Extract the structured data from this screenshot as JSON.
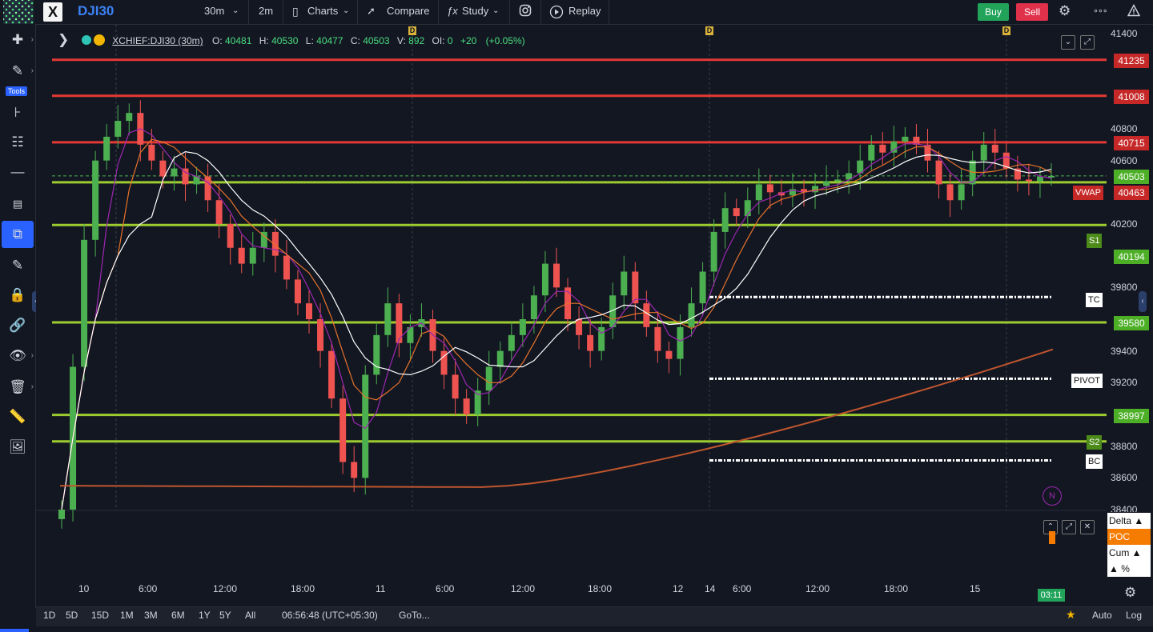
{
  "topbar": {
    "symbol": "DJI30",
    "interval": "30m",
    "interval2": "2m",
    "charts_label": "Charts",
    "compare_label": "Compare",
    "study_label": "Study",
    "replay_label": "Replay",
    "buy_label": "Buy",
    "sell_label": "Sell",
    "more_label": "∘∘∘"
  },
  "tools": {
    "tools_label": "Tools"
  },
  "legend": {
    "title": "XCHIEF:DJI30 (30m)",
    "o_label": "O:",
    "o": "40481",
    "h_label": "H:",
    "h": "40530",
    "l_label": "L:",
    "l": "40477",
    "c_label": "C:",
    "c": "40503",
    "v_label": "V:",
    "v": "892",
    "oi_label": "OI:",
    "oi": "0",
    "change": "+20",
    "change_pct": "(+0.05%)"
  },
  "price_axis": {
    "ticks": [
      "41400",
      "40800",
      "40600",
      "40200",
      "39800",
      "39400",
      "39200",
      "38800",
      "38600",
      "38400"
    ],
    "tag_41235": "41235",
    "tag_41008": "41008",
    "tag_40715": "40715",
    "tag_40503": "40503",
    "tag_40463": "40463",
    "tag_40194": "40194",
    "tag_39580": "39580",
    "tag_38997": "38997"
  },
  "chart_tags": {
    "vwap": "VWAP",
    "s1": "S1",
    "s2": "S2",
    "tc": "TC",
    "pivot": "PIVOT",
    "bc": "BC",
    "n": "N",
    "d": "D"
  },
  "time_axis": {
    "labels": [
      "10",
      "6:00",
      "12:00",
      "18:00",
      "11",
      "6:00",
      "12:00",
      "18:00",
      "12",
      "14",
      "6:00",
      "12:00",
      "18:00",
      "15"
    ],
    "countdown": "03:11"
  },
  "volume_panel": {
    "delta": "Delta ▲",
    "poc": "POC",
    "cum": "Cum ▲",
    "pct": "▲ %"
  },
  "bottombar": {
    "ranges": [
      "1D",
      "5D",
      "15D",
      "1M",
      "3M",
      "6M",
      "1Y",
      "5Y",
      "All"
    ],
    "clock": "06:56:48 (UTC+05:30)",
    "goto": "GoTo...",
    "auto": "Auto",
    "log": "Log"
  },
  "colors": {
    "bull": "#4caf50",
    "bear": "#ef5350",
    "resistance": "#e53935",
    "support": "#9ccc2f",
    "ma_white": "#ffffff",
    "ma_purple": "#9c27b0",
    "ma_orange": "#e6722a",
    "accent": "#2962ff"
  },
  "chart_data": {
    "type": "candlestick",
    "symbol": "XCHIEF:DJI30 (30m)",
    "ylim": [
      38400,
      41400
    ],
    "horizontal_levels": [
      {
        "value": 41235,
        "color": "red"
      },
      {
        "value": 41008,
        "color": "red"
      },
      {
        "value": 40715,
        "color": "red"
      },
      {
        "value": 40463,
        "label": "VWAP",
        "color": "green"
      },
      {
        "value": 40194,
        "label": "S1",
        "color": "green"
      },
      {
        "value": 39580,
        "color": "green"
      },
      {
        "value": 38997,
        "color": "green"
      },
      {
        "value": 38830,
        "label": "S2",
        "color": "green"
      }
    ],
    "pivot_levels": [
      {
        "label": "TC",
        "value": 39740
      },
      {
        "label": "PIVOT",
        "value": 39225
      },
      {
        "label": "BC",
        "value": 38710
      }
    ],
    "last_price": 40503,
    "closes": [
      38400,
      39300,
      40100,
      40600,
      40750,
      40850,
      40900,
      40700,
      40600,
      40500,
      40550,
      40450,
      40500,
      40350,
      40200,
      40050,
      39950,
      40050,
      40150,
      40000,
      39850,
      39700,
      39600,
      39400,
      39100,
      38700,
      38600,
      39250,
      39500,
      39700,
      39450,
      39550,
      39600,
      39400,
      39250,
      39100,
      39000,
      39150,
      39300,
      39400,
      39500,
      39600,
      39750,
      39950,
      39800,
      39600,
      39500,
      39400,
      39550,
      39750,
      39900,
      39700,
      39550,
      39400,
      39350,
      39550,
      39700,
      39900,
      40150,
      40300,
      40250,
      40350,
      40450,
      40400,
      40380,
      40420,
      40400,
      40440,
      40470,
      40480,
      40520,
      40600,
      40700,
      40650,
      40720,
      40750,
      40700,
      40600,
      40450,
      40350,
      40450,
      40600,
      40700,
      40650,
      40550,
      40480,
      40470,
      40500,
      40503
    ]
  }
}
